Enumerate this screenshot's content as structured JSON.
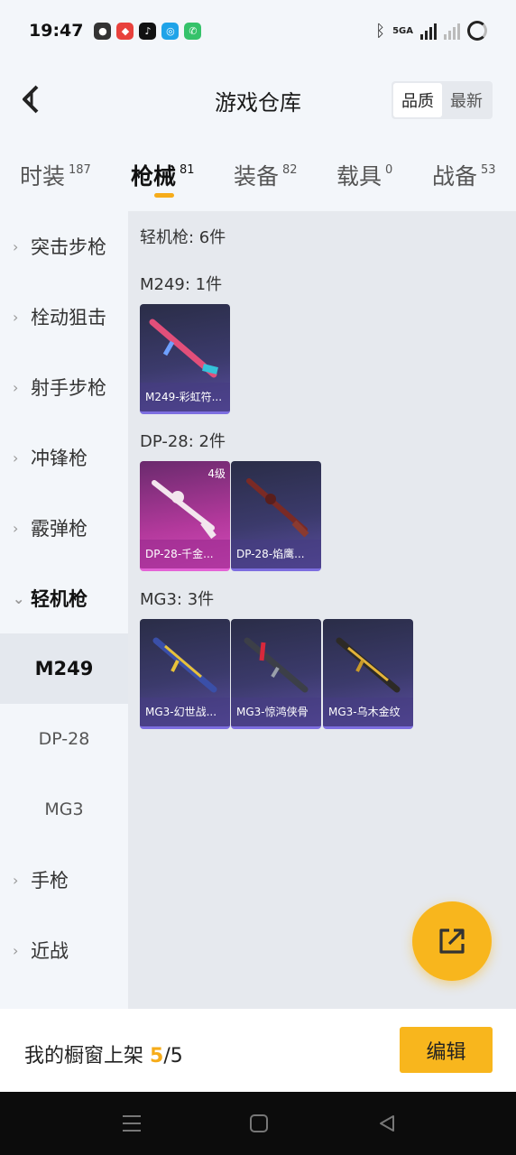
{
  "status_bar": {
    "time": "19:47",
    "network": "5GA"
  },
  "header": {
    "title": "游戏仓库",
    "sort_options": [
      "品质",
      "最新"
    ]
  },
  "tabs": [
    {
      "label": "时装",
      "count": "187"
    },
    {
      "label": "枪械",
      "count": "81"
    },
    {
      "label": "装备",
      "count": "82"
    },
    {
      "label": "载具",
      "count": "0"
    },
    {
      "label": "战备",
      "count": "53"
    }
  ],
  "sidebar": {
    "categories": [
      "突击步枪",
      "栓动狙击",
      "射手步枪",
      "冲锋枪",
      "霰弹枪",
      "轻机枪"
    ],
    "subitems": [
      "M249",
      "DP-28",
      "MG3"
    ],
    "after": [
      "手枪",
      "近战"
    ]
  },
  "content": {
    "category_title": "轻机枪: 6件",
    "groups": [
      {
        "title": "M249: 1件",
        "items": [
          "M249-彩虹符..."
        ]
      },
      {
        "title": "DP-28: 2件",
        "items": [
          "DP-28-千金...",
          "DP-28-焰鹰..."
        ],
        "level_badge": "4级"
      },
      {
        "title": "MG3: 3件",
        "items": [
          "MG3-幻世战...",
          "MG3-惊鸿侠骨",
          "MG3-乌木金纹"
        ]
      }
    ]
  },
  "bottom": {
    "showcase_label": "我的橱窗上架",
    "showcase_current": "5",
    "showcase_sep_total": "/5",
    "edit_label": "编辑"
  },
  "colors": {
    "accent": "#f8b61d"
  }
}
